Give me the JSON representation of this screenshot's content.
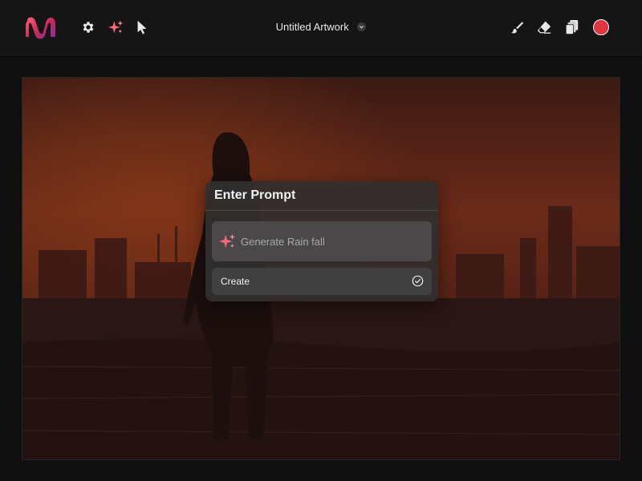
{
  "app": {
    "title": "Untitled Artwork"
  },
  "toolbar_left": {
    "icons": [
      "logo-icon",
      "gear-icon",
      "sparkles-icon",
      "cursor-icon"
    ]
  },
  "toolbar_right": {
    "icons": [
      "brush-icon",
      "eraser-icon",
      "layers-icon",
      "record-icon"
    ]
  },
  "dialog": {
    "title": "Enter Prompt",
    "prompt_value": "",
    "prompt_placeholder": "Generate Rain fall",
    "create_label": "Create"
  },
  "colors": {
    "accent_red": "#e1353f",
    "sparkle": "#ff6a7a",
    "topbar": "#151515",
    "dialog_bg": "#302e2e"
  }
}
